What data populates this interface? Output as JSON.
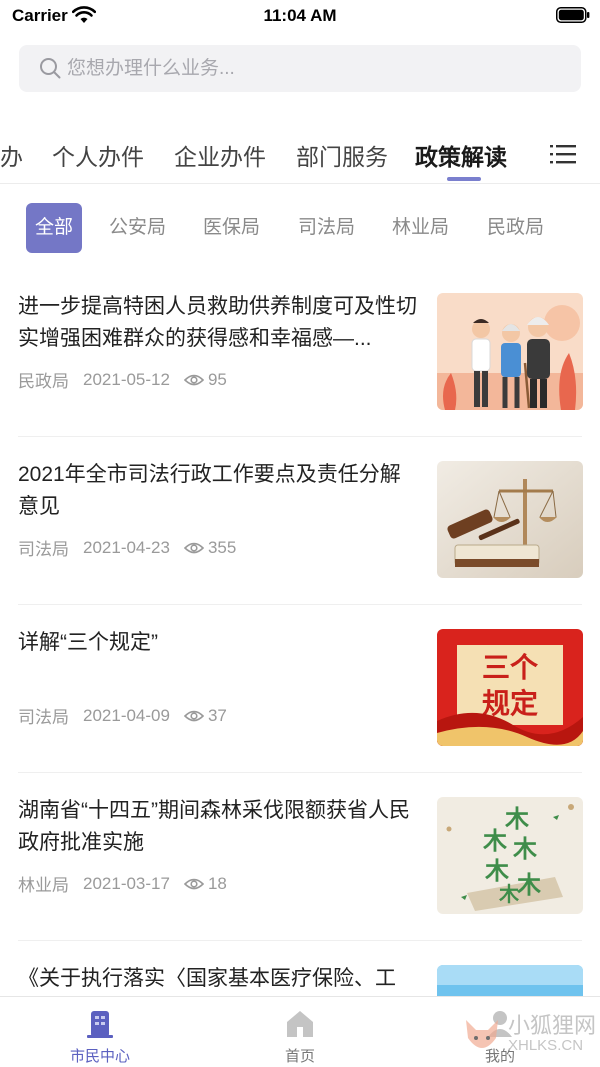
{
  "status_bar": {
    "carrier": "Carrier",
    "time": "11:04 AM"
  },
  "search": {
    "placeholder": "您想办理什么业务..."
  },
  "tabs": [
    {
      "label": "办"
    },
    {
      "label": "个人办件"
    },
    {
      "label": "企业办件"
    },
    {
      "label": "部门服务"
    },
    {
      "label": "政策解读",
      "active": true
    }
  ],
  "filters": [
    {
      "label": "全部",
      "active": true
    },
    {
      "label": "公安局"
    },
    {
      "label": "医保局"
    },
    {
      "label": "司法局"
    },
    {
      "label": "林业局"
    },
    {
      "label": "民政局"
    }
  ],
  "news": [
    {
      "title": "进一步提高特困人员救助供养制度可及性切实增强困难群众的获得感和幸福感—...",
      "department": "民政局",
      "date": "2021-05-12",
      "views": "95",
      "thumbnail": "elderly-care-illustration"
    },
    {
      "title": "2021年全市司法行政工作要点及责任分解意见",
      "department": "司法局",
      "date": "2021-04-23",
      "views": "355",
      "thumbnail": "gavel-and-scales-photo"
    },
    {
      "title": "详解“三个规定”",
      "department": "司法局",
      "date": "2021-04-09",
      "views": "37",
      "thumbnail": "red-banner-three-rules",
      "thumb_lines": [
        "三个",
        "规定"
      ]
    },
    {
      "title": "湖南省“十四五”期间森林采伐限额获省人民政府批准实施",
      "department": "林业局",
      "date": "2021-03-17",
      "views": "18",
      "thumbnail": "forest-characters-illustration",
      "thumb_glyphs": [
        "木",
        "木",
        "木",
        "木",
        "木",
        "木"
      ]
    },
    {
      "title": "《关于执行落实〈国家基本医疗保险、工",
      "department": "",
      "date": "",
      "views": "",
      "thumbnail": "blue-medical-banner"
    }
  ],
  "bottom_nav": [
    {
      "label": "市民中心",
      "icon": "building-icon",
      "active": true
    },
    {
      "label": "首页",
      "icon": "home-icon"
    },
    {
      "label": "我的",
      "icon": "user-icon"
    }
  ],
  "watermark": {
    "line1": "小狐狸网",
    "line2": "XHLKS.CN"
  },
  "colors": {
    "accent": "#7477c6",
    "tab_indicator": "#7a7fce",
    "nav_active": "#5b60c0",
    "meta_text": "#9a9a9a"
  }
}
